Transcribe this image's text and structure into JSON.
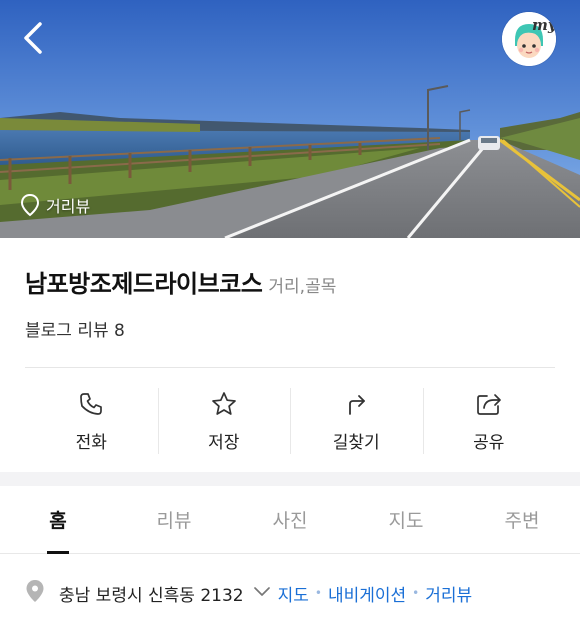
{
  "hero": {
    "streetview_label": "거리뷰",
    "avatar_text": "my"
  },
  "place": {
    "name": "남포방조제드라이브코스",
    "category": "거리,골목",
    "review_text": "블로그 리뷰 8"
  },
  "actions": [
    {
      "label": "전화",
      "icon": "phone-icon"
    },
    {
      "label": "저장",
      "icon": "star-icon"
    },
    {
      "label": "길찾기",
      "icon": "directions-icon"
    },
    {
      "label": "공유",
      "icon": "share-icon"
    }
  ],
  "tabs": [
    {
      "label": "홈",
      "active": true
    },
    {
      "label": "리뷰",
      "active": false
    },
    {
      "label": "사진",
      "active": false
    },
    {
      "label": "지도",
      "active": false
    },
    {
      "label": "주변",
      "active": false
    }
  ],
  "address": {
    "text": "충남 보령시 신흑동 2132",
    "links": [
      "지도",
      "내비게이션",
      "거리뷰"
    ]
  },
  "colors": {
    "link": "#1a6fd6",
    "sky": "#3f73c9",
    "road_line": "#e8c23a"
  }
}
